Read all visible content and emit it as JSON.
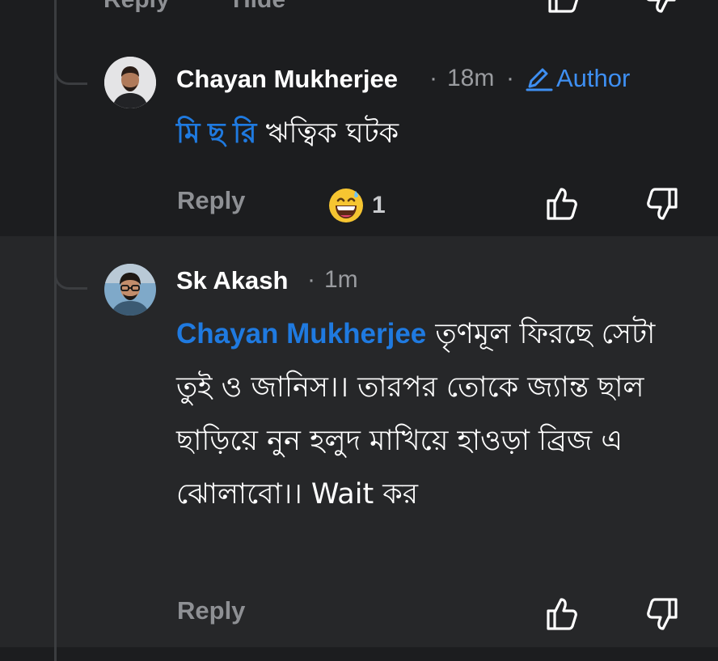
{
  "top_partial": {
    "reply_label": "Reply",
    "hide_label": "Hide"
  },
  "comment1": {
    "author_name": "Chayan Mukherjee",
    "separator": "·",
    "time": "18m",
    "author_badge": "Author",
    "mention": "মি ছ রি",
    "text": " ঋত্বিক ঘটক",
    "reply_label": "Reply",
    "reaction_emoji": "grinning-sweat-face",
    "reaction_count": "1"
  },
  "comment2": {
    "author_name": "Sk Akash",
    "separator": "·",
    "time": "1m",
    "mention": "Chayan Mukherjee",
    "text": " তৃণমূল ফিরছে সেটা তুই ও জানিস।। তারপর তোকে জ্যান্ত ছাল ছাড়িয়ে নুন হলুদ মাখিয়ে হাওড়া ব্রিজ এ ঝোলাবো।। Wait কর",
    "reply_label": "Reply"
  },
  "colors": {
    "accent": "#1f7ae0",
    "author": "#3e8ff2",
    "muted": "#8e9094"
  }
}
